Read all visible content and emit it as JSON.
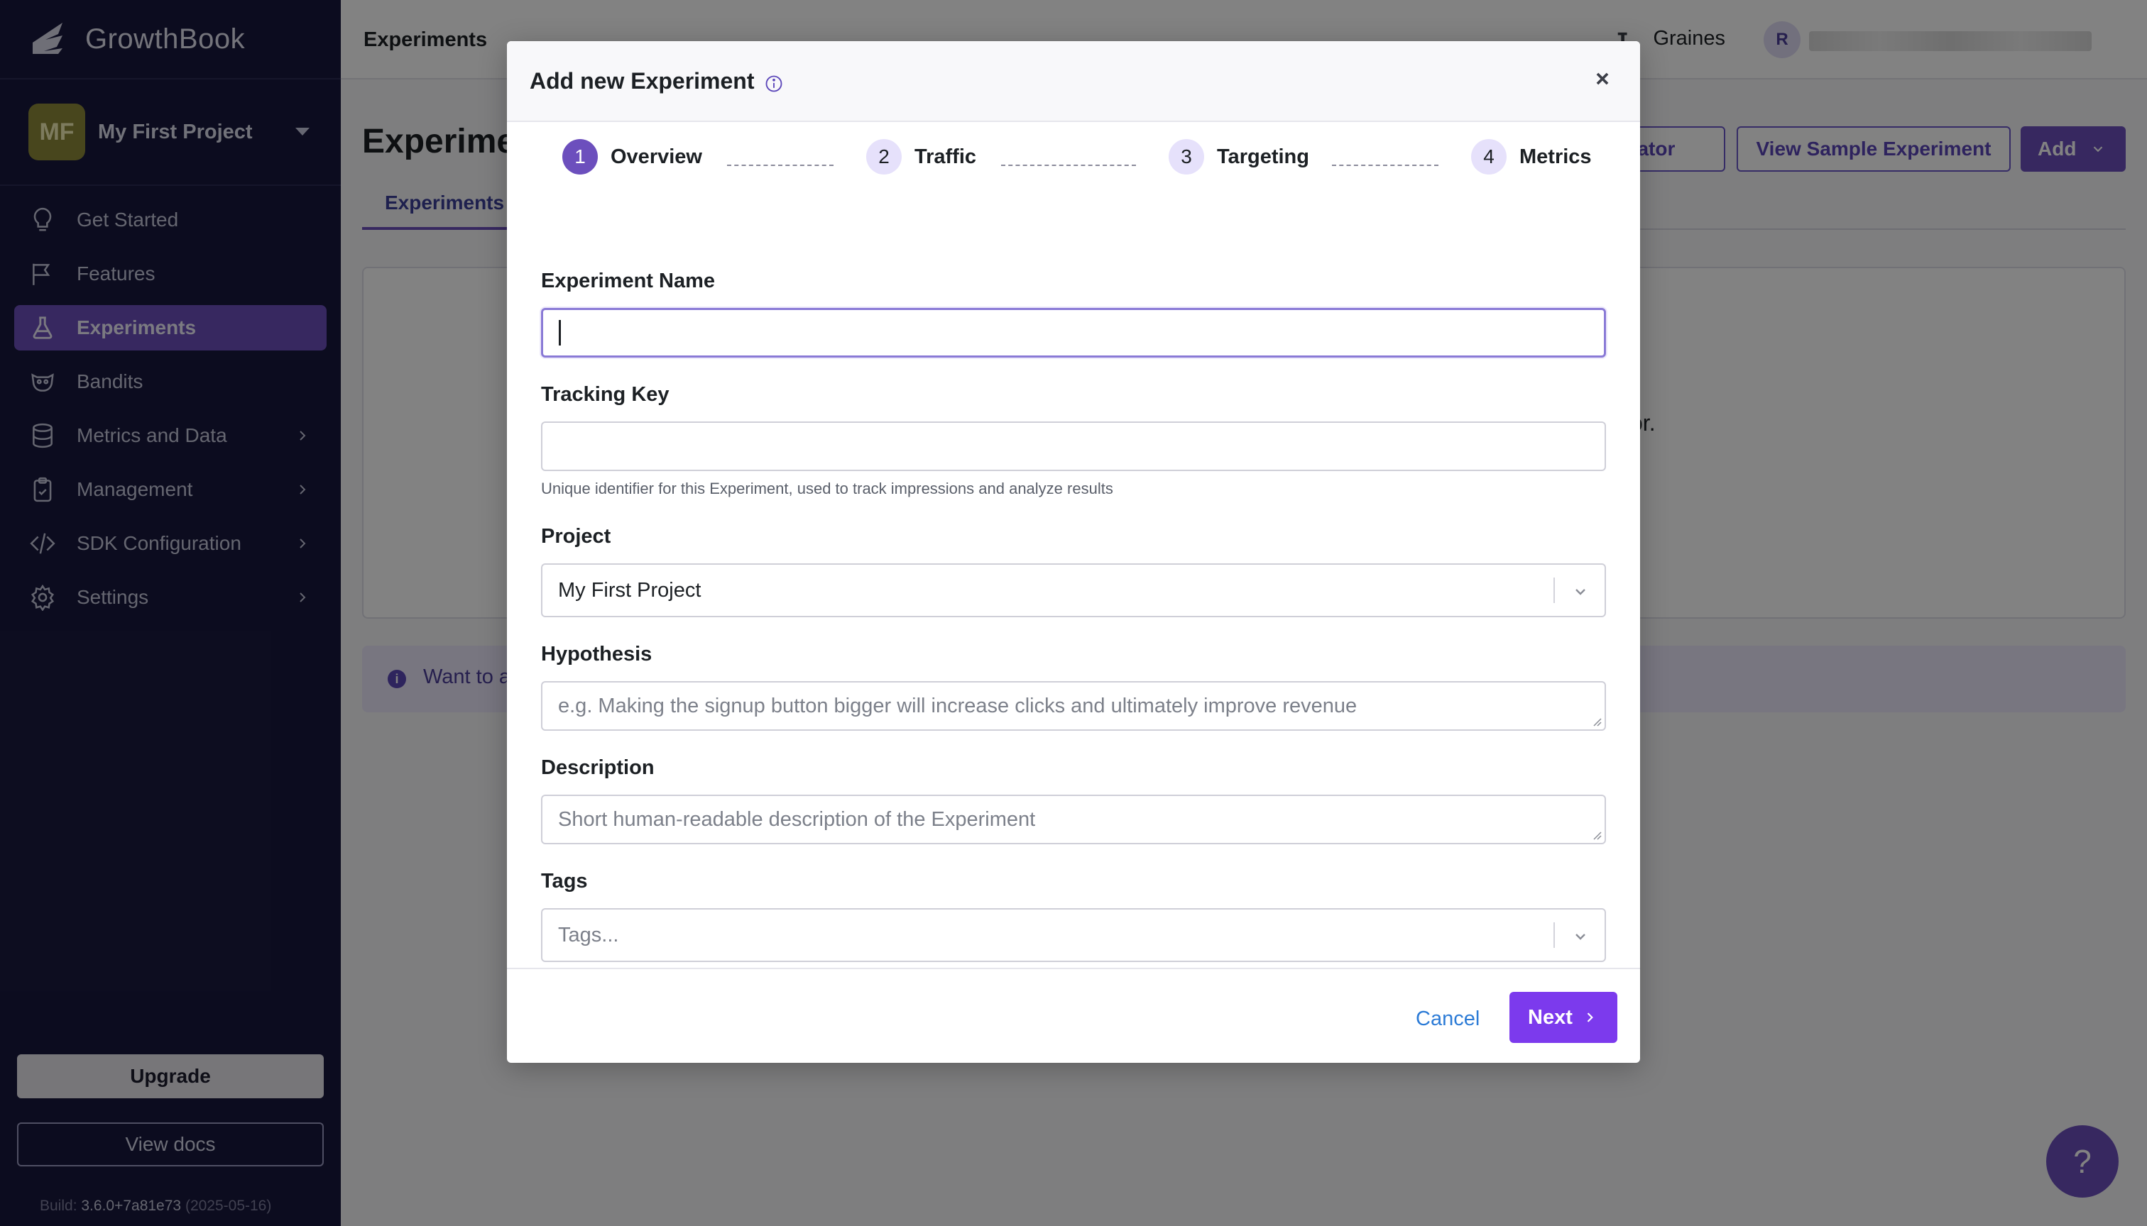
{
  "app": {
    "name": "GrowthBook"
  },
  "sidebar": {
    "project": {
      "initials": "MF",
      "name": "My First Project"
    },
    "items": [
      {
        "label": "Get Started",
        "icon": "lightbulb-icon"
      },
      {
        "label": "Features",
        "icon": "flag-icon"
      },
      {
        "label": "Experiments",
        "icon": "flask-icon",
        "active": true
      },
      {
        "label": "Bandits",
        "icon": "bandit-icon"
      },
      {
        "label": "Metrics and Data",
        "icon": "database-icon"
      },
      {
        "label": "Management",
        "icon": "clipboard-icon"
      },
      {
        "label": "SDK Configuration",
        "icon": "code-icon"
      },
      {
        "label": "Settings",
        "icon": "gear-icon"
      }
    ],
    "upgrade_label": "Upgrade",
    "docs_label": "View docs",
    "build": {
      "prefix": "Build:",
      "version": "3.6.0+7a81e73",
      "date": "(2025-05-16)"
    }
  },
  "topbar": {
    "title": "Experiments",
    "org": "Graines",
    "user_initial": "R"
  },
  "page": {
    "title": "Experiments",
    "calculator_label": "culator",
    "sample_label": "View Sample Experiment",
    "add_label": "Add",
    "tab_label": "Experiments",
    "card_text": "or.",
    "banner_text": "Want to a"
  },
  "modal": {
    "title": "Add new Experiment",
    "steps": [
      {
        "num": "1",
        "label": "Overview",
        "active": true
      },
      {
        "num": "2",
        "label": "Traffic"
      },
      {
        "num": "3",
        "label": "Targeting"
      },
      {
        "num": "4",
        "label": "Metrics"
      }
    ],
    "fields": {
      "name_label": "Experiment Name",
      "name_value": "",
      "tracking_label": "Tracking Key",
      "tracking_value": "",
      "tracking_help": "Unique identifier for this Experiment, used to track impressions and analyze results",
      "project_label": "Project",
      "project_value": "My First Project",
      "hypothesis_label": "Hypothesis",
      "hypothesis_placeholder": "e.g. Making the signup button bigger will increase clicks and ultimately improve revenue",
      "description_label": "Description",
      "description_placeholder": "Short human-readable description of the Experiment",
      "tags_label": "Tags",
      "tags_placeholder": "Tags..."
    },
    "cancel_label": "Cancel",
    "next_label": "Next"
  },
  "help_label": "?",
  "colors": {
    "sidebar": "#19193e",
    "accent": "#6c4fbd",
    "next": "#7c3aed",
    "link": "#2c7bd6"
  }
}
